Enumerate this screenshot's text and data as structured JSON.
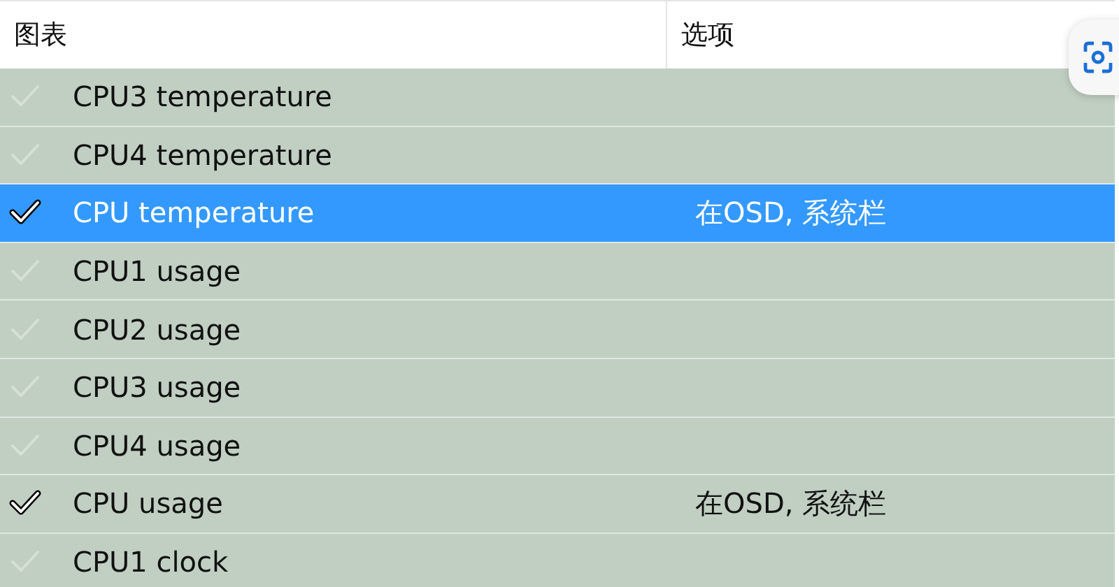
{
  "table": {
    "columns": [
      "图表",
      "选项"
    ],
    "rows": [
      {
        "name": "CPU3 temperature",
        "options": "",
        "checked": false,
        "selected": false
      },
      {
        "name": "CPU4 temperature",
        "options": "",
        "checked": false,
        "selected": false
      },
      {
        "name": "CPU temperature",
        "options": "在OSD, 系统栏",
        "checked": true,
        "selected": true
      },
      {
        "name": "CPU1 usage",
        "options": "",
        "checked": false,
        "selected": false
      },
      {
        "name": "CPU2 usage",
        "options": "",
        "checked": false,
        "selected": false
      },
      {
        "name": "CPU3 usage",
        "options": "",
        "checked": false,
        "selected": false
      },
      {
        "name": "CPU4 usage",
        "options": "",
        "checked": false,
        "selected": false
      },
      {
        "name": "CPU usage",
        "options": "在OSD, 系统栏",
        "checked": true,
        "selected": false
      },
      {
        "name": "CPU1 clock",
        "options": "",
        "checked": false,
        "selected": false
      }
    ]
  }
}
